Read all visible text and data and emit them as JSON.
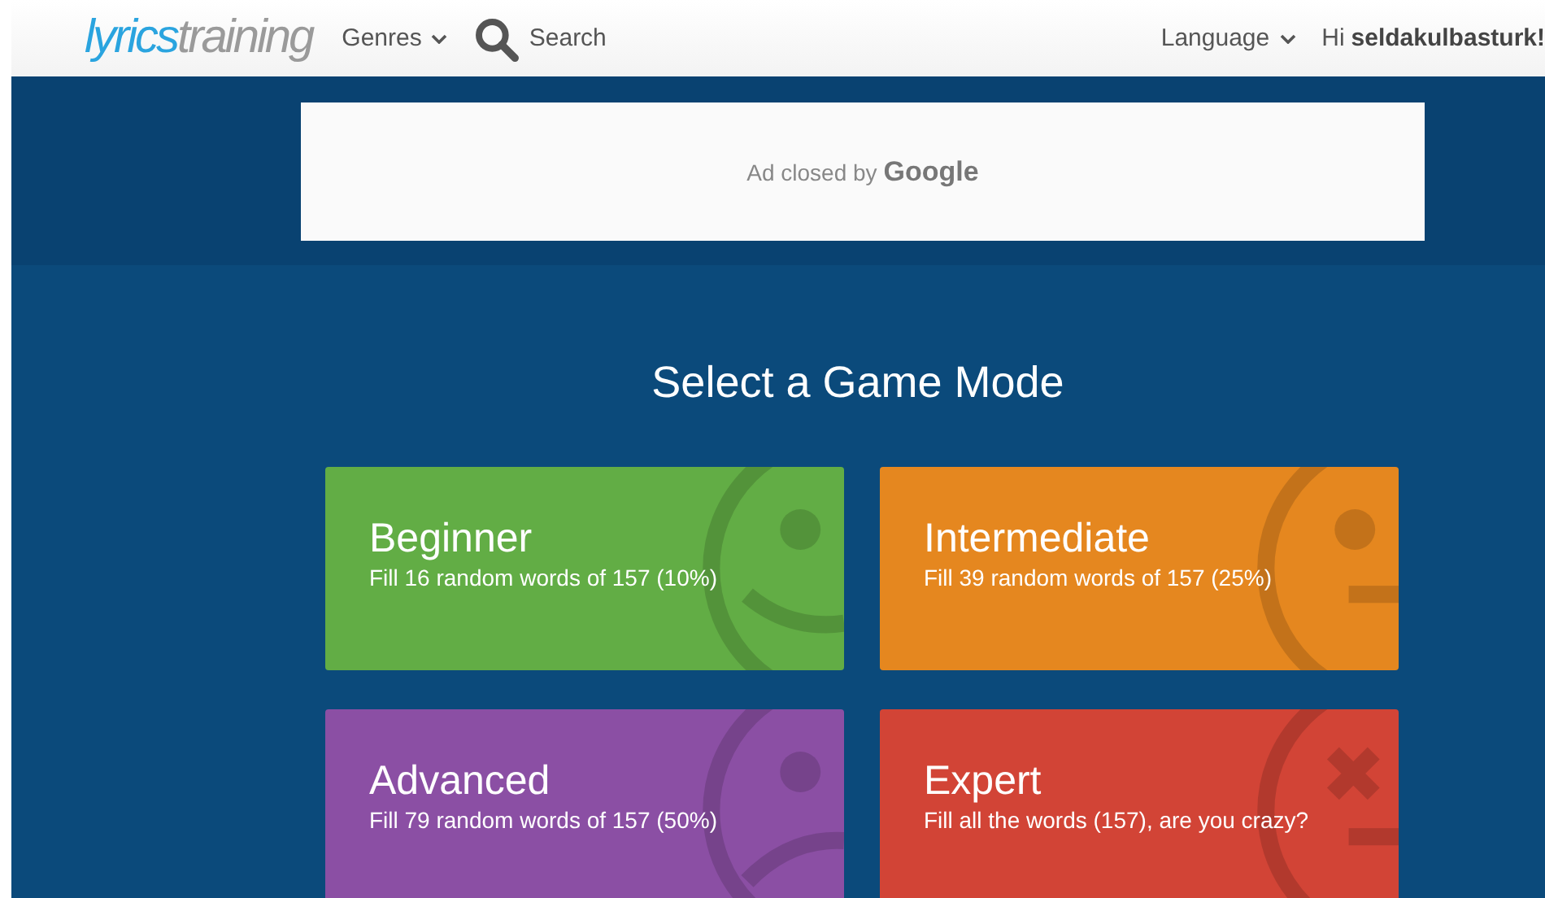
{
  "header": {
    "logo": {
      "part_1": "lyrics",
      "part_2": "training"
    },
    "genres": "Genres",
    "search": "Search",
    "language": "Language",
    "greeting": {
      "prefix": "Hi",
      "user": "seldakulbasturk!"
    }
  },
  "ad": {
    "text": "Ad closed by",
    "brand": "Google"
  },
  "title": "Select a Game Mode",
  "modes": [
    {
      "name": "Beginner",
      "description": "Fill 16 random words of 157 (10%)",
      "color": "#62ad45",
      "kind": "happy"
    },
    {
      "name": "Intermediate",
      "description": "Fill 39 random words of 157 (25%)",
      "color": "#e5871f",
      "kind": "neutral"
    },
    {
      "name": "Advanced",
      "description": "Fill 79 random words of 157 (50%)",
      "color": "#8b4fa4",
      "kind": "sad"
    },
    {
      "name": "Expert",
      "description": "Fill all the words (157), are you crazy?",
      "color": "#d24436",
      "kind": "cross"
    }
  ]
}
